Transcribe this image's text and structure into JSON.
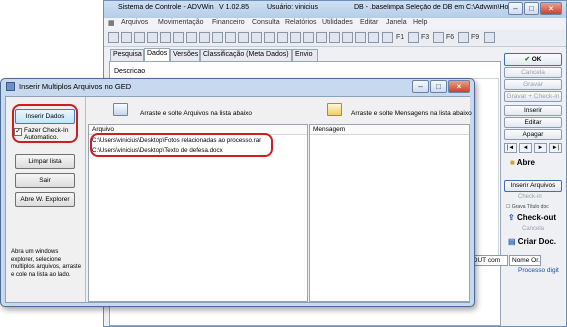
{
  "back_window": {
    "title_left": "Sistema de Controle - ADVWin",
    "version": "V 1.02.85",
    "user": "Usuário: vinicius",
    "db": "DB - .baselimpa  Seleção de DB em C:\\Advwin\\Hom...",
    "controls": {
      "minimize": "–",
      "maximize": "□",
      "close": "×"
    },
    "menu": [
      "Arquivos",
      "Movimentação",
      "Financeiro",
      "Consulta",
      "Relatórios",
      "Utilidades",
      "Editar",
      "Janela",
      "Help"
    ],
    "toolbar": {
      "f1": "F1",
      "f3": "F3",
      "f6": "F6",
      "f9": "F9"
    },
    "tabs": [
      "Pesquisa",
      "Dados",
      "Versões",
      "Classificação (Meta Dados)",
      "Envio"
    ],
    "active_tab": "Dados",
    "description_label": "Descricao",
    "right_buttons": {
      "ok": "OK",
      "cancela": "Cancela",
      "gravar": "Gravar",
      "gravar_checkin": "Gravar + Check-in",
      "inserir": "Inserir",
      "editar": "Editar",
      "apagar": "Apagar",
      "nav_first": "|◄",
      "nav_prev": "◄",
      "nav_next": "►",
      "nav_last": "►|",
      "abre": "Abre",
      "inserir_arquivos": "Inserir Arquivos",
      "check_in": "Check-in",
      "grava_titulo": "Grava Título doc",
      "check_out": "Check-out",
      "cancela2": "Cancela",
      "criar_doc": "Criar Doc."
    },
    "bottom_field": "k-OUT com",
    "bottom_select": "Nome Or.",
    "processo": "Processo digit"
  },
  "dialog": {
    "title": "Inserir Multiplos Arquivos no GED",
    "buttons": {
      "inserir_dados": "Inserir Dados",
      "limpar_lista": "Limpar lista",
      "sair": "Sair",
      "abre_explorer": "Abre W. Explorer"
    },
    "checkbox": {
      "label": "Fazer Check-In Automatico.",
      "checked": true
    },
    "help_text": "Abra um windows explorer, selecione multiplos arquivos, arraste e cole na lista ao lado.",
    "drop_files_label": "Arraste e solte Arquivos na lista abaixo",
    "drop_messages_label": "Arraste e solte Mensagens na lista abaixo",
    "files_column": "Arquivo",
    "messages_column": "Mensagem",
    "files": [
      "C:\\Users\\vinicius\\Desktop\\Fotos relacionadas ao processo.rar",
      "C:\\Users\\vinicius\\Desktop\\Texto de defesa.docx"
    ],
    "highlight_color": "#d11c22",
    "accent_color": "#3c7fb1"
  }
}
